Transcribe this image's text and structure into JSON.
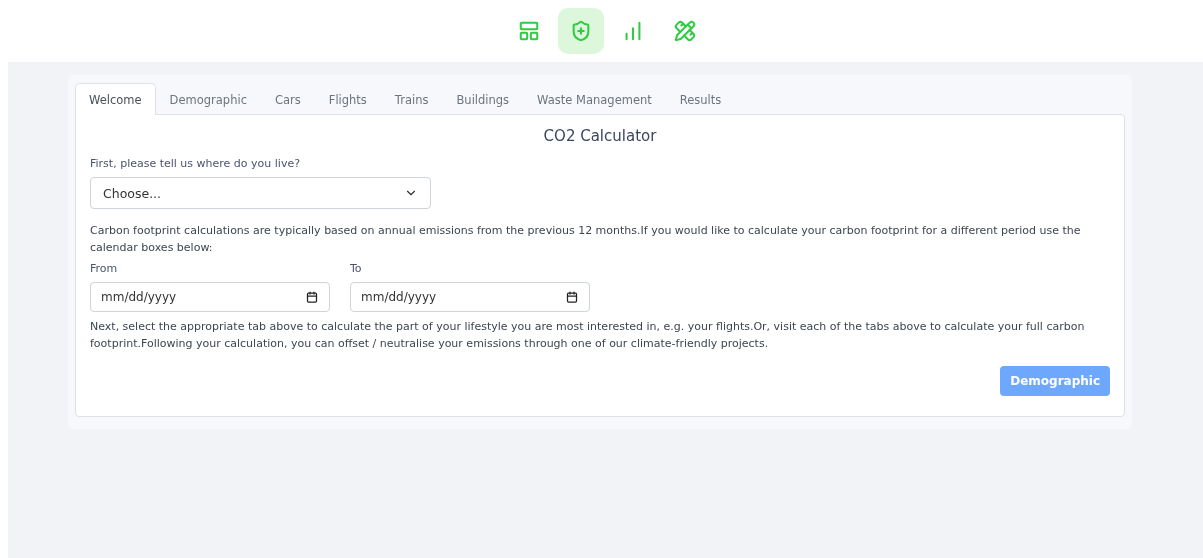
{
  "nav": [
    {
      "selected": false
    },
    {
      "selected": true
    },
    {
      "selected": false
    },
    {
      "selected": false
    }
  ],
  "tabs": [
    {
      "label": "Welcome",
      "selected": true
    },
    {
      "label": "Demographic",
      "selected": false
    },
    {
      "label": "Cars",
      "selected": false
    },
    {
      "label": "Flights",
      "selected": false
    },
    {
      "label": "Trains",
      "selected": false
    },
    {
      "label": "Buildings",
      "selected": false
    },
    {
      "label": "Waste Management",
      "selected": false
    },
    {
      "label": "Results",
      "selected": false
    }
  ],
  "title": "CO2 Calculator",
  "location": {
    "label": "First, please tell us where do you live?",
    "value": "Choose..."
  },
  "period_note": "Carbon footprint calculations are typically based on annual emissions from the previous 12 months.If you would like to calculate your carbon footprint for a different period use the calendar boxes below:",
  "dates": [
    {
      "label": "From",
      "placeholder": "mm/dd/yyyy"
    },
    {
      "label": "To",
      "placeholder": "mm/dd/yyyy"
    }
  ],
  "next_note": "Next, select the appropriate tab above to calculate the part of your lifestyle you are most interested in, e.g. your flights.Or, visit each of the tabs above to calculate your full carbon footprint.Following your calculation, you can offset / neutralise your emissions through one of our climate-friendly projects.",
  "next_button": "Demographic"
}
